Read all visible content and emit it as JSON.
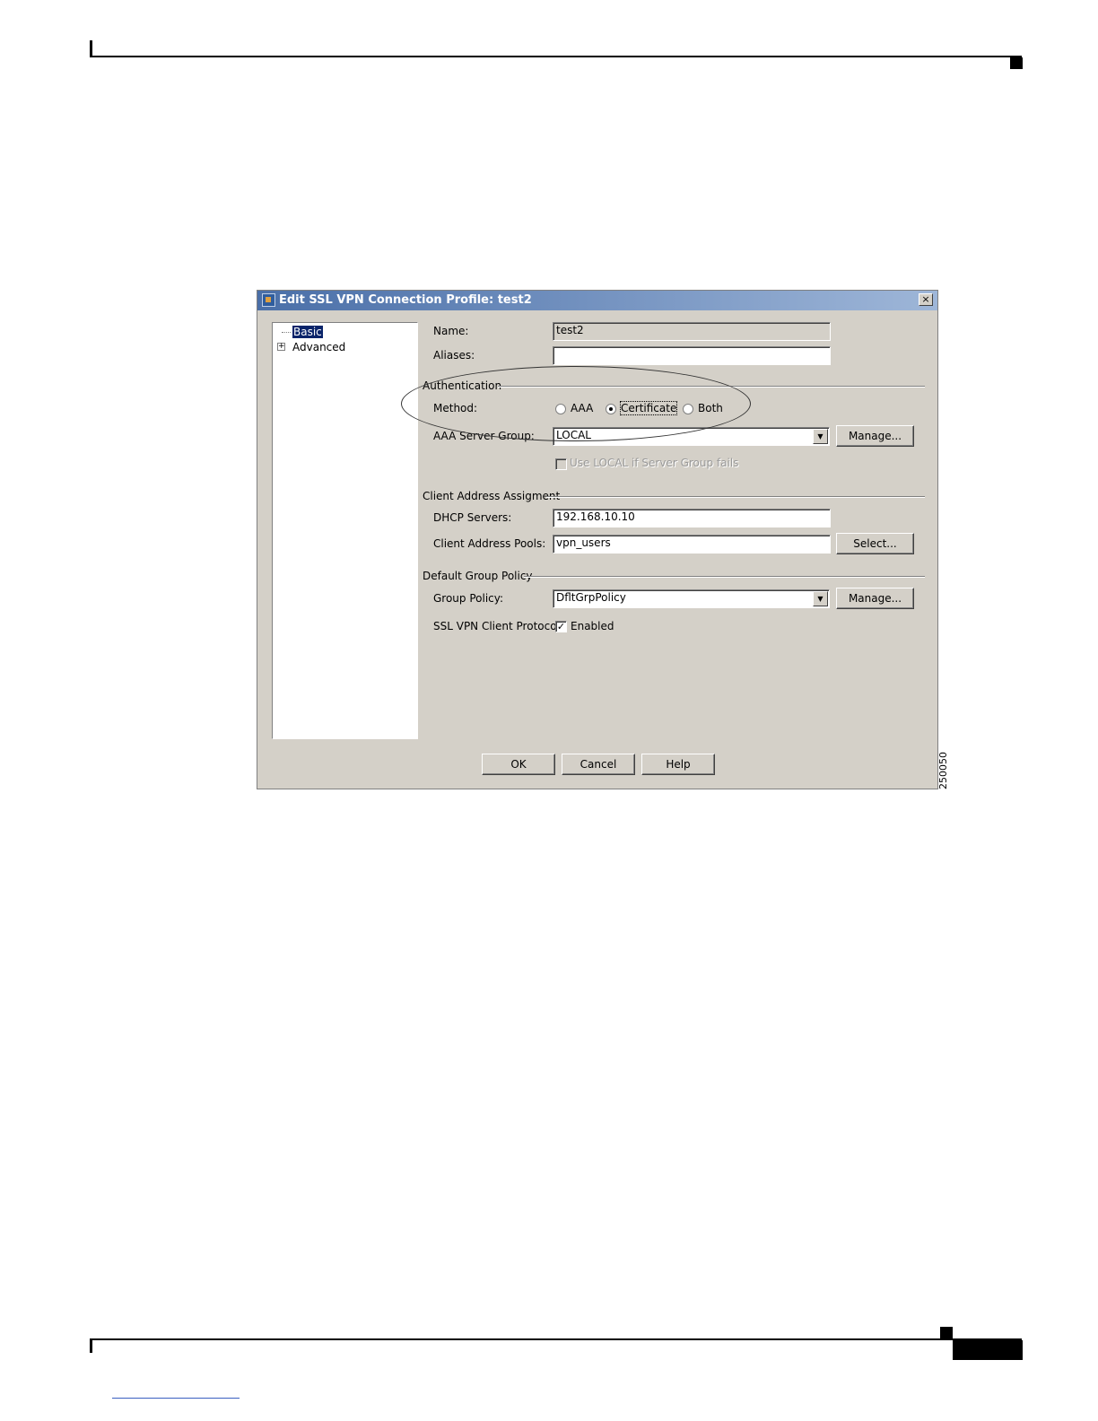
{
  "dialog": {
    "title": "Edit SSL VPN Connection Profile: test2",
    "close_glyph": "×"
  },
  "tree": {
    "items": [
      {
        "label": "Basic",
        "selected": true
      },
      {
        "label": "Advanced",
        "expander": "+"
      }
    ]
  },
  "form": {
    "name_label": "Name:",
    "name_value": "test2",
    "aliases_label": "Aliases:",
    "aliases_value": "",
    "auth_group": "Authentication",
    "method_label": "Method:",
    "method_options": [
      "AAA",
      "Certificate",
      "Both"
    ],
    "method_selected": "Certificate",
    "aaa_server_group_label": "AAA Server Group:",
    "aaa_server_group_value": "LOCAL",
    "aaa_manage_label": "Manage...",
    "use_local_label": "Use LOCAL if Server Group fails",
    "client_group": "Client Address Assigment",
    "dhcp_label": "DHCP Servers:",
    "dhcp_value": "192.168.10.10",
    "pools_label": "Client Address Pools:",
    "pools_value": "vpn_users",
    "select_label": "Select...",
    "default_policy_group": "Default Group Policy",
    "group_policy_label": "Group Policy:",
    "group_policy_value": "DfltGrpPolicy",
    "policy_manage_label": "Manage...",
    "ssl_client_label": "SSL VPN Client Protocol:",
    "enabled_label": "Enabled",
    "enabled_checked": true
  },
  "buttons": {
    "ok": "OK",
    "cancel": "Cancel",
    "help": "Help"
  },
  "figure_id": "250050",
  "icons": {
    "combo_arrow": "▼",
    "check": "✓"
  }
}
